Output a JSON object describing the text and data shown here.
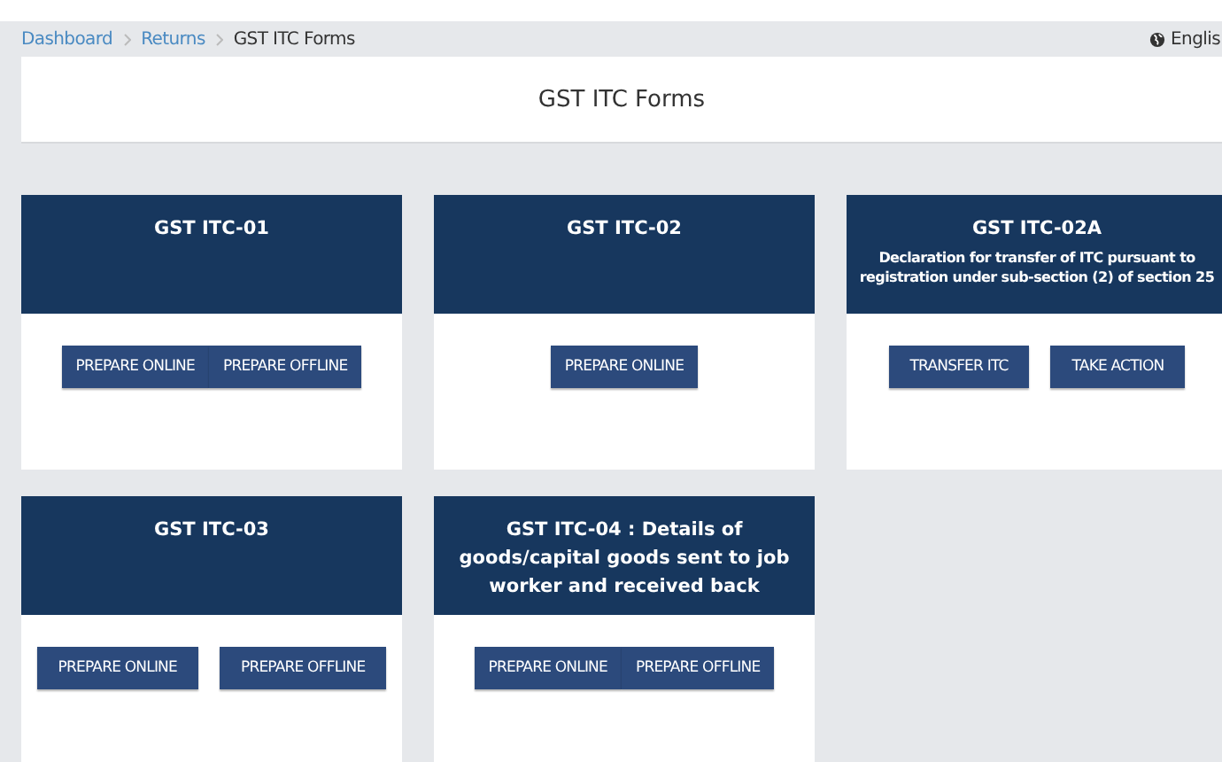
{
  "breadcrumb": [
    {
      "label": "Dashboard",
      "link": true
    },
    {
      "label": "Returns",
      "link": true
    },
    {
      "label": "GST ITC Forms",
      "link": false
    }
  ],
  "language": "Englis",
  "page_title": "GST ITC Forms",
  "cards": [
    {
      "title": "GST ITC-01",
      "buttons": [
        "PREPARE ONLINE",
        "PREPARE OFFLINE"
      ],
      "joined": true
    },
    {
      "title": "GST ITC-02",
      "buttons": [
        "PREPARE ONLINE"
      ],
      "joined": true
    },
    {
      "title": "GST ITC-02A",
      "subtitle": "Declaration for transfer of ITC pursuant to registration under sub-section (2) of section 25",
      "buttons": [
        "TRANSFER ITC",
        "TAKE ACTION"
      ],
      "joined": false
    },
    {
      "title": "GST ITC-03",
      "buttons": [
        "PREPARE ONLINE",
        "PREPARE OFFLINE"
      ],
      "joined": false
    },
    {
      "title": "GST ITC-04 : Details of goods/capital goods sent to job worker and received back",
      "buttons": [
        "PREPARE ONLINE",
        "PREPARE OFFLINE"
      ],
      "joined": true
    }
  ]
}
